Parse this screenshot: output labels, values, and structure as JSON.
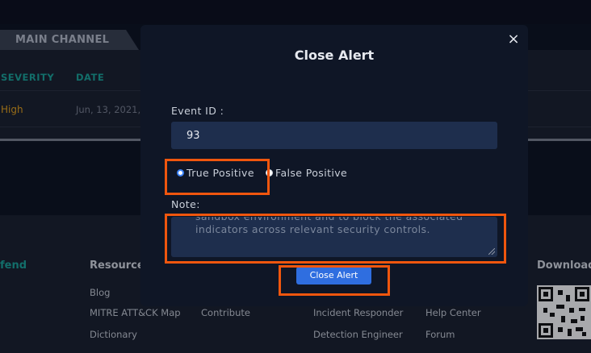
{
  "background": {
    "channel_tab": "MAIN CHANNEL",
    "table": {
      "headers": [
        "SEVERITY",
        "DATE"
      ],
      "row": {
        "severity": "High",
        "date": "Jun, 13, 2021,"
      }
    },
    "footer": {
      "brand": "fend",
      "resources_title": "Resource",
      "download_title": "Download",
      "links": [
        "Blog",
        "MITRE ATT&CK Map",
        "Dictionary",
        "Contribute",
        "Incident Responder",
        "Detection Engineer",
        "Help Center",
        "Forum"
      ]
    }
  },
  "modal": {
    "title": "Close Alert",
    "close_icon": "×",
    "event_id_label": "Event ID :",
    "event_id_value": "93",
    "radio_options": [
      {
        "label": "True Positive",
        "selected": true
      },
      {
        "label": "False Positive",
        "selected": false
      }
    ],
    "note_label": "Note:",
    "note_text": "sandbox environment and to block the associated indicators across relevant security controls.",
    "submit_label": "Close Alert"
  },
  "colors": {
    "accent_teal": "#1aa59a",
    "severity_high": "#e6a21b",
    "button_blue": "#2f6ee0",
    "highlight": "#f0560e"
  }
}
